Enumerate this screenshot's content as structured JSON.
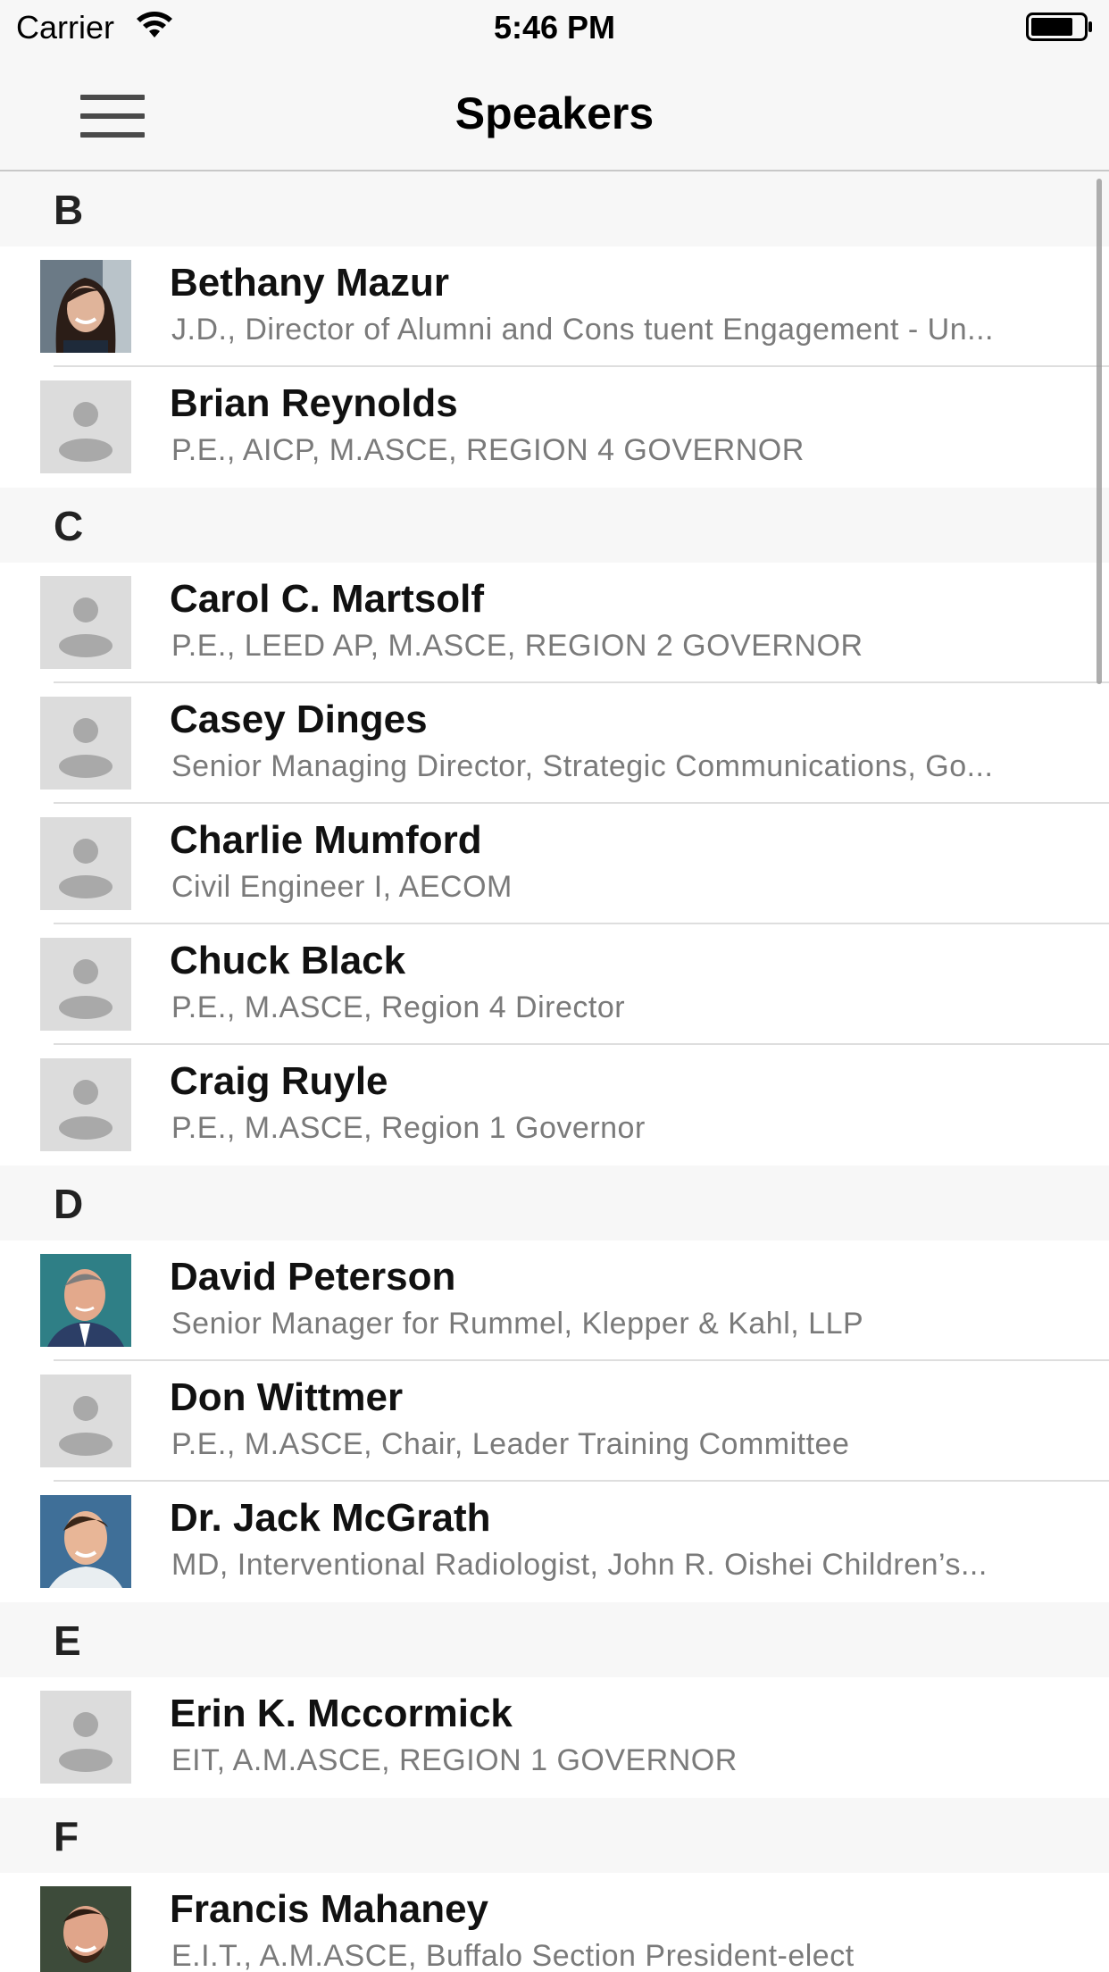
{
  "status_bar": {
    "carrier": "Carrier",
    "time": "5:46 PM",
    "wifi_icon": "wifi-icon",
    "battery_icon": "battery-icon"
  },
  "nav": {
    "title": "Speakers",
    "menu_icon": "hamburger-menu-icon"
  },
  "sections": [
    {
      "letter": "B",
      "speakers": [
        {
          "name": "Bethany Mazur",
          "subtitle": "J.D., Director of Alumni and Cons tuent Engagement - Un...",
          "avatar": "photo"
        },
        {
          "name": "Brian Reynolds",
          "subtitle": "P.E., AICP, M.ASCE, REGION 4 GOVERNOR",
          "avatar": "placeholder"
        }
      ]
    },
    {
      "letter": "C",
      "speakers": [
        {
          "name": "Carol C. Martsolf",
          "subtitle": "P.E., LEED AP, M.ASCE, REGION 2 GOVERNOR",
          "avatar": "placeholder"
        },
        {
          "name": "Casey Dinges",
          "subtitle": "Senior Managing Director, Strategic Communications, Go...",
          "avatar": "placeholder"
        },
        {
          "name": "Charlie Mumford",
          "subtitle": "Civil Engineer I, AECOM",
          "avatar": "placeholder"
        },
        {
          "name": "Chuck Black",
          "subtitle": "P.E., M.ASCE, Region 4 Director",
          "avatar": "placeholder"
        },
        {
          "name": "Craig Ruyle",
          "subtitle": "P.E., M.ASCE, Region 1 Governor",
          "avatar": "placeholder"
        }
      ]
    },
    {
      "letter": "D",
      "speakers": [
        {
          "name": "David Peterson",
          "subtitle": "Senior Manager for Rummel, Klepper & Kahl, LLP",
          "avatar": "photo"
        },
        {
          "name": "Don Wittmer",
          "subtitle": "P.E., M.ASCE, Chair, Leader Training Committee",
          "avatar": "placeholder"
        },
        {
          "name": "Dr. Jack McGrath",
          "subtitle": "MD, Interventional Radiologist, John R. Oishei Children’s...",
          "avatar": "photo"
        }
      ]
    },
    {
      "letter": "E",
      "speakers": [
        {
          "name": "Erin K. Mccormick",
          "subtitle": "EIT, A.M.ASCE, REGION 1 GOVERNOR",
          "avatar": "placeholder"
        }
      ]
    },
    {
      "letter": "F",
      "speakers": [
        {
          "name": "Francis Mahaney",
          "subtitle": "E.I.T., A.M.ASCE, Buffalo Section President-elect",
          "avatar": "photo"
        }
      ]
    }
  ],
  "colors": {
    "nav_background": "#f7f7f7",
    "section_background": "#f7f7f7",
    "subtitle_gray": "#7a7a7a",
    "placeholder_bg": "#dcdcdc",
    "placeholder_fg": "#a9a9a9"
  }
}
